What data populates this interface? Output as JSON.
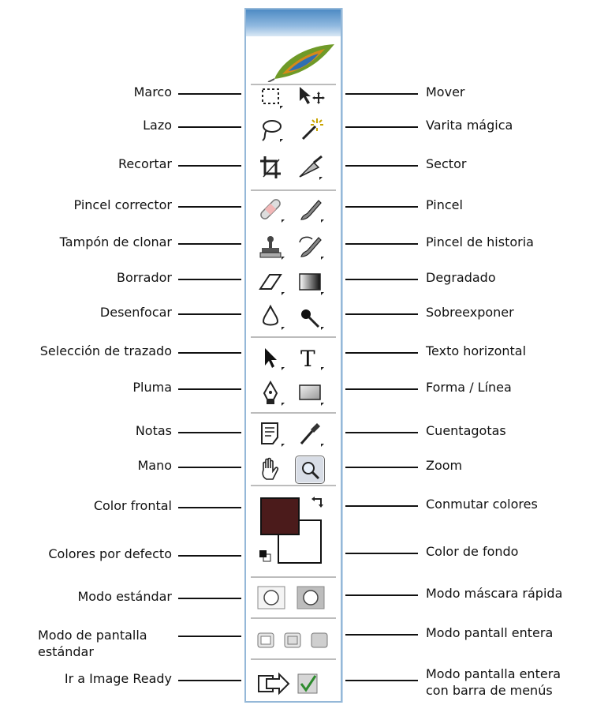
{
  "left_labels": [
    {
      "id": "marco",
      "text": "Marco"
    },
    {
      "id": "lazo",
      "text": "Lazo"
    },
    {
      "id": "recortar",
      "text": "Recortar"
    },
    {
      "id": "pincel-corrector",
      "text": "Pincel corrector"
    },
    {
      "id": "tampon",
      "text": "Tampón de clonar"
    },
    {
      "id": "borrador",
      "text": "Borrador"
    },
    {
      "id": "desenfocar",
      "text": "Desenfocar"
    },
    {
      "id": "seleccion-trazado",
      "text": "Selección de trazado"
    },
    {
      "id": "pluma",
      "text": "Pluma"
    },
    {
      "id": "notas",
      "text": "Notas"
    },
    {
      "id": "mano",
      "text": "Mano"
    },
    {
      "id": "color-frontal",
      "text": "Color frontal"
    },
    {
      "id": "colores-defecto",
      "text": "Colores por defecto"
    },
    {
      "id": "modo-estandar",
      "text": "Modo estándar"
    },
    {
      "id": "modo-pantalla-estandar",
      "text": "Modo de pantalla estándar"
    },
    {
      "id": "image-ready",
      "text": "Ir a Image Ready"
    }
  ],
  "right_labels": [
    {
      "id": "mover",
      "text": "Mover"
    },
    {
      "id": "varita",
      "text": "Varita mágica"
    },
    {
      "id": "sector",
      "text": "Sector"
    },
    {
      "id": "pincel",
      "text": "Pincel"
    },
    {
      "id": "pincel-historia",
      "text": "Pincel de historia"
    },
    {
      "id": "degradado",
      "text": "Degradado"
    },
    {
      "id": "sobreexponer",
      "text": "Sobreexponer"
    },
    {
      "id": "texto-horizontal",
      "text": "Texto horizontal"
    },
    {
      "id": "forma-linea",
      "text": "Forma / Línea"
    },
    {
      "id": "cuentagotas",
      "text": "Cuentagotas"
    },
    {
      "id": "zoom",
      "text": "Zoom"
    },
    {
      "id": "conmutar",
      "text": "Conmutar colores"
    },
    {
      "id": "color-fondo",
      "text": "Color de fondo"
    },
    {
      "id": "mascara-rapida",
      "text": "Modo máscara rápida"
    },
    {
      "id": "pantalla-entera",
      "text": "Modo pantall entera"
    },
    {
      "id": "pantalla-entera-menus",
      "text": "Modo pantalla entera con barra de menús"
    }
  ],
  "colors": {
    "foreground": "#4b1b1b",
    "background": "#ffffff",
    "panel_border": "#95b8d8"
  },
  "icons": [
    "rect-marquee-icon",
    "move-icon",
    "lasso-icon",
    "magic-wand-icon",
    "crop-icon",
    "slice-icon",
    "healing-brush-icon",
    "brush-icon",
    "clone-stamp-icon",
    "history-brush-icon",
    "eraser-icon",
    "gradient-icon",
    "blur-drop-icon",
    "dodge-icon",
    "path-selection-arrow-icon",
    "text-t-icon",
    "pen-icon",
    "shape-rectangle-icon",
    "notes-icon",
    "eyedropper-icon",
    "hand-icon",
    "zoom-magnifier-icon",
    "swap-colors-icon",
    "default-colors-icon",
    "standard-mode-icon",
    "quick-mask-icon",
    "screen-mode-icons",
    "image-ready-icon",
    "feather-logo-icon"
  ]
}
